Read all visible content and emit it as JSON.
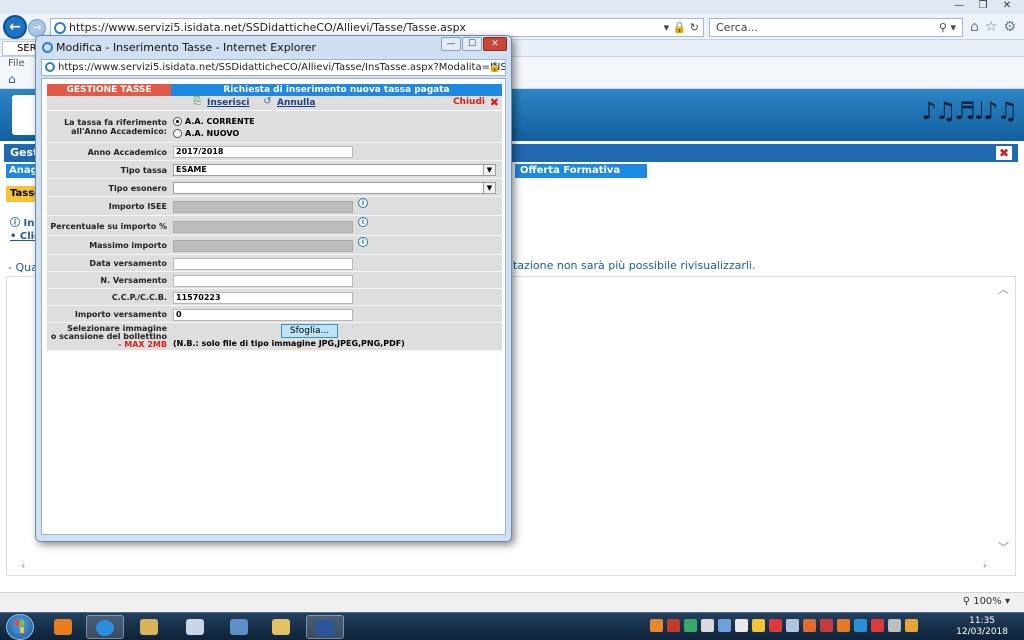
{
  "browser": {
    "url": "https://www.servizi5.isidata.net/SSDidatticheCO/Allievi/Tasse/Tasse.aspx",
    "search_placeholder": "Cerca...",
    "tab_label": "SERV",
    "menu_label": "File"
  },
  "page": {
    "header_title": "Gesti",
    "tab_anag": "Anag",
    "tab_offerta": "Offerta Formativa",
    "tab_tasse": "Tasse",
    "info_label": "In",
    "link_clic": "Clic",
    "line_qual": "- Qual",
    "note_text": "tazione non sarà più possibile rivisualizzarli."
  },
  "popup": {
    "title": "Modifica - Inserimento Tasse - Internet Explorer",
    "url": "https://www.servizi5.isidata.net/SSDidatticheCO/Allievi/Tasse/InsTasse.aspx?Modalita=INS&idTassa=0",
    "header_left": "GESTIONE TASSE",
    "header_right": "Richiesta di inserimento nuova tassa pagata",
    "action_inserisci": "Inserisci",
    "action_annulla": "Annulla",
    "action_chiudi": "Chiudi",
    "form": {
      "rif_label_1": "La tassa fa riferimento",
      "rif_label_2": "all'Anno Accademico:",
      "radio_corrente": "A.A. CORRENTE",
      "radio_nuovo": "A.A. NUOVO",
      "anno_label": "Anno Accademico",
      "anno_value": "2017/2018",
      "tipo_tassa_label": "Tipo tassa",
      "tipo_tassa_value": "ESAME",
      "tipo_esonero_label": "Tipo esonero",
      "tipo_esonero_value": "",
      "isee_label": "Importo ISEE",
      "perc_label": "Percentuale su importo %",
      "max_label": "Massimo importo",
      "data_label": "Data versamento",
      "data_value": "",
      "nvers_label": "N. Versamento",
      "nvers_value": "",
      "ccp_label": "C.C.P./C.C.B.",
      "ccp_value": "11570223",
      "importo_label": "Importo versamento",
      "importo_value": "0",
      "img_label_1": "Selezionare immagine",
      "img_label_2": "o scansione del bollettino",
      "img_label_3": "- MAX 2MB",
      "sfoglia": "Sfoglia...",
      "nb": "(N.B.: solo file di tipo immagine JPG,JPEG,PNG,PDF)"
    }
  },
  "status": {
    "zoom": "100%"
  },
  "taskbar": {
    "time": "11:35",
    "date": "12/03/2018"
  }
}
